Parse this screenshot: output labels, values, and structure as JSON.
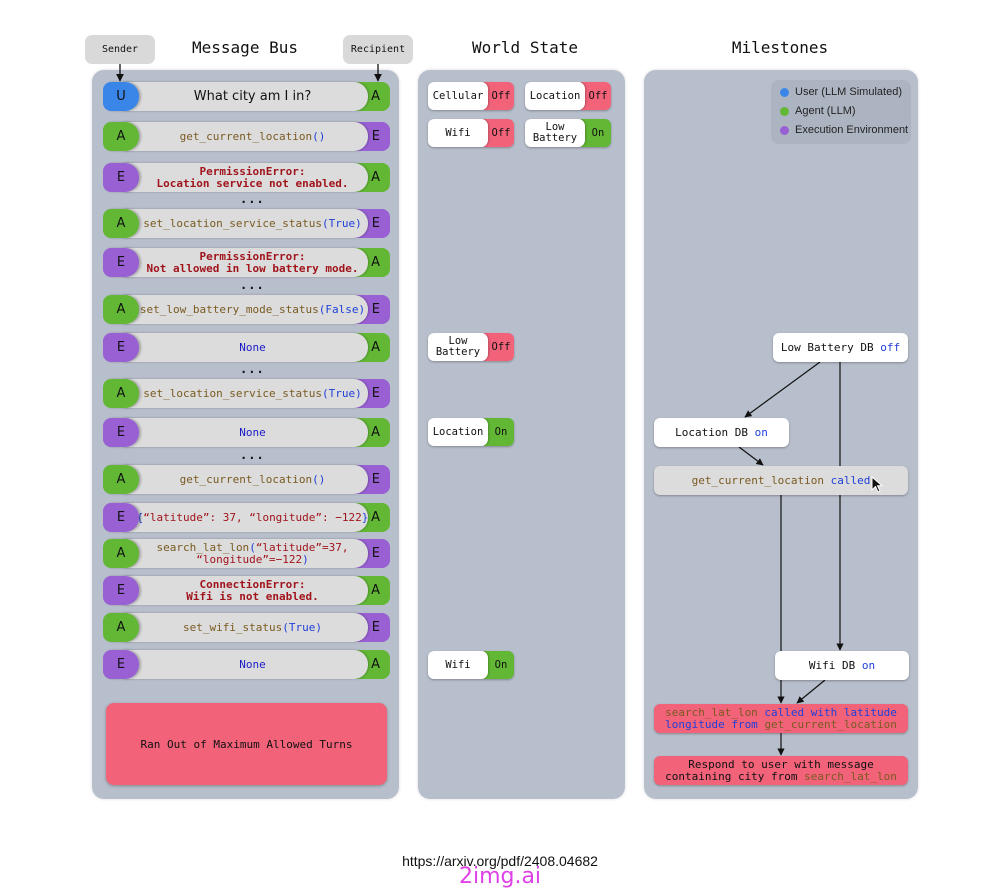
{
  "titles": {
    "message_bus": "Message Bus",
    "world_state": "World State",
    "milestones": "Milestones"
  },
  "tags": {
    "sender": "Sender",
    "recipient": "Recipient"
  },
  "colors": {
    "user": "#3a86e8",
    "agent": "#62b835",
    "env": "#9960d4",
    "off": "#f2637a",
    "on": "#62b835"
  },
  "messages": [
    {
      "from": "U",
      "to": "A",
      "parts": [
        {
          "t": "What city am I in?",
          "c": "plain"
        }
      ]
    },
    {
      "from": "A",
      "to": "E",
      "parts": [
        {
          "t": "get_current_location",
          "c": "fn"
        },
        {
          "t": "()",
          "c": "kw"
        }
      ]
    },
    {
      "from": "E",
      "to": "A",
      "parts": [
        {
          "t": "PermissionError:",
          "c": "err"
        },
        {
          "br": true
        },
        {
          "t": "Location service not enabled.",
          "c": "err"
        }
      ]
    },
    {
      "from": "A",
      "to": "E",
      "parts": [
        {
          "t": "set_location_service_status",
          "c": "fn"
        },
        {
          "t": "(True)",
          "c": "kw"
        }
      ]
    },
    {
      "from": "E",
      "to": "A",
      "parts": [
        {
          "t": "PermissionError:",
          "c": "err"
        },
        {
          "br": true
        },
        {
          "t": "Not allowed in low battery mode.",
          "c": "err"
        }
      ]
    },
    {
      "from": "A",
      "to": "E",
      "parts": [
        {
          "t": "set_low_battery_mode_status",
          "c": "fn"
        },
        {
          "t": "(False)",
          "c": "kw"
        }
      ]
    },
    {
      "from": "E",
      "to": "A",
      "parts": [
        {
          "t": "None",
          "c": "none"
        }
      ]
    },
    {
      "from": "A",
      "to": "E",
      "parts": [
        {
          "t": "set_location_service_status",
          "c": "fn"
        },
        {
          "t": "(True)",
          "c": "kw"
        }
      ]
    },
    {
      "from": "E",
      "to": "A",
      "parts": [
        {
          "t": "None",
          "c": "none"
        }
      ]
    },
    {
      "from": "A",
      "to": "E",
      "parts": [
        {
          "t": "get_current_location",
          "c": "fn"
        },
        {
          "t": "()",
          "c": "kw"
        }
      ]
    },
    {
      "from": "E",
      "to": "A",
      "parts": [
        {
          "t": "{",
          "c": "kw"
        },
        {
          "t": "“latitude”: 37, “longitude”: −122",
          "c": "err2"
        },
        {
          "t": "}",
          "c": "kw"
        }
      ]
    },
    {
      "from": "A",
      "to": "E",
      "parts": [
        {
          "t": "search_lat_lon",
          "c": "fn"
        },
        {
          "t": "(",
          "c": "kw"
        },
        {
          "t": "“latitude”=37,",
          "c": "err2"
        },
        {
          "br": true
        },
        {
          "t": "“longitude”=−122",
          "c": "err2"
        },
        {
          "t": ")",
          "c": "kw"
        }
      ]
    },
    {
      "from": "E",
      "to": "A",
      "parts": [
        {
          "t": "ConnectionError:",
          "c": "err"
        },
        {
          "br": true
        },
        {
          "t": "Wifi is not enabled.",
          "c": "err"
        }
      ]
    },
    {
      "from": "A",
      "to": "E",
      "parts": [
        {
          "t": "set_wifi_status",
          "c": "fn"
        },
        {
          "t": "(True)",
          "c": "kw"
        }
      ]
    },
    {
      "from": "E",
      "to": "A",
      "parts": [
        {
          "t": "None",
          "c": "none"
        }
      ]
    }
  ],
  "ellipsis": "...",
  "final_status": "Ran Out of Maximum Allowed Turns",
  "world_state_initial": [
    {
      "label": "Cellular",
      "value": "Off",
      "state": "off"
    },
    {
      "label": "Location",
      "value": "Off",
      "state": "off"
    },
    {
      "label": "Wifi",
      "value": "Off",
      "state": "off"
    },
    {
      "label": "Low Battery",
      "value": "On",
      "state": "on"
    }
  ],
  "world_state_changes": [
    {
      "label": "Low Battery",
      "value": "Off",
      "state": "off"
    },
    {
      "label": "Location",
      "value": "On",
      "state": "on"
    },
    {
      "label": "Wifi",
      "value": "On",
      "state": "on"
    }
  ],
  "legend": [
    {
      "label": "User (LLM Simulated)",
      "color": "#3a86e8"
    },
    {
      "label": "Agent (LLM)",
      "color": "#62b835"
    },
    {
      "label": "Execution Environment",
      "color": "#9960d4"
    }
  ],
  "milestones": {
    "low_battery": {
      "main": "Low Battery DB ",
      "state": "off"
    },
    "location": {
      "main": "Location DB ",
      "state": "on"
    },
    "get_location": {
      "fn": "get_current_location",
      "rest": " called"
    },
    "wifi": {
      "main": "Wifi DB ",
      "state": "on"
    },
    "search": {
      "fn1": "search_lat_lon",
      "mid1": " called with latitude",
      "mid2": "longitude from ",
      "fn2": "get_current_location"
    },
    "respond": {
      "line1": "Respond to user with message",
      "line2": "containing city from ",
      "fn": "search_lat_lon"
    }
  },
  "footer": {
    "url": "https://arxiv.org/pdf/2408.04682",
    "watermark": "2img.ai"
  }
}
